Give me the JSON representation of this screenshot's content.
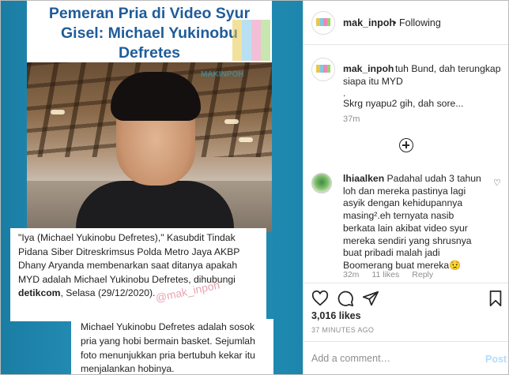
{
  "post_image": {
    "title": "Pemeran Pria di Video Syur Gisel: Michael Yukinobu Defretes",
    "watermark_photo": "MAKINPOH",
    "quote_parts": {
      "p1": "\"Iya (Michael Yukinobu Defretes),\" Kasubdit Tindak Pidana Siber Ditreskrimsus Polda Metro Jaya AKBP Dhany Aryanda membenarkan saat ditanya apakah MYD adalah Michael Yukinobu Defretes, dihubungi ",
      "bold": "detikcom",
      "p2": ", Selasa (29/12/2020)."
    },
    "watermark_text": "@mak_inpoh",
    "description": "Michael Yukinobu Defretes adalah sosok pria yang hobi bermain basket. Sejumlah foto menunjukkan pria bertubuh kekar itu menjalankan hobinya."
  },
  "header": {
    "username": "mak_inpoh",
    "separator": "•",
    "following_label": "Following"
  },
  "caption": {
    "username": "mak_inpoh",
    "line1": "tuh Bund, dah terungkap",
    "line2": "siapa itu MYD",
    "line3": ".",
    "line4": "Skrg nyapu2 gih, dah sore...",
    "time": "37m"
  },
  "comment": {
    "username": "lhiaalken",
    "text": " Padahal udah 3 tahun loh dan mereka pastinya lagi asyik dengan kehidupannya masing².eh ternyata nasib berkata lain akibat video syur mereka sendiri yang shrusnya buat pribadi malah jadi Boomerang buat mereka😟",
    "time": "32m",
    "likes": "11 likes",
    "reply_label": "Reply"
  },
  "actions": {
    "likes_count": "3,016 likes",
    "post_time": "37 MINUTES AGO",
    "add_comment_placeholder": "Add a comment…",
    "post_label": "Post"
  },
  "icons": {
    "like": "heart-icon",
    "comment": "comment-icon",
    "share": "share-icon",
    "save": "bookmark-icon",
    "load_more": "plus-circle-icon"
  },
  "colors": {
    "title_blue": "#1f5c9a",
    "background_teal": "#1f8cb4",
    "watermark_pink": "#e59aa8",
    "post_button": "#b3dbff"
  }
}
